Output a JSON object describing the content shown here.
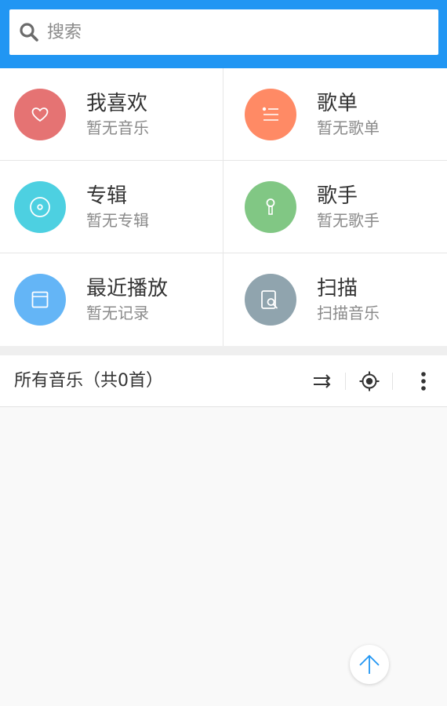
{
  "search": {
    "placeholder": "搜索"
  },
  "tiles": [
    {
      "title": "我喜欢",
      "subtitle": "暂无音乐",
      "icon": "heart-icon",
      "color": "#e57373"
    },
    {
      "title": "歌单",
      "subtitle": "暂无歌单",
      "icon": "playlist-icon",
      "color": "#ff8a65"
    },
    {
      "title": "专辑",
      "subtitle": "暂无专辑",
      "icon": "album-disc-icon",
      "color": "#4dd0e1"
    },
    {
      "title": "歌手",
      "subtitle": "暂无歌手",
      "icon": "microphone-icon",
      "color": "#81c784"
    },
    {
      "title": "最近播放",
      "subtitle": "暂无记录",
      "icon": "recent-icon",
      "color": "#64b5f6"
    },
    {
      "title": "扫描",
      "subtitle": "扫描音乐",
      "icon": "scan-file-icon",
      "color": "#90a4ae"
    }
  ],
  "music_list": {
    "label": "所有音乐（共0首）",
    "tools": [
      "shuffle-icon",
      "locate-icon",
      "more-vertical-icon"
    ]
  },
  "colors": {
    "header": "#2196f3",
    "accent": "#2196f3"
  }
}
